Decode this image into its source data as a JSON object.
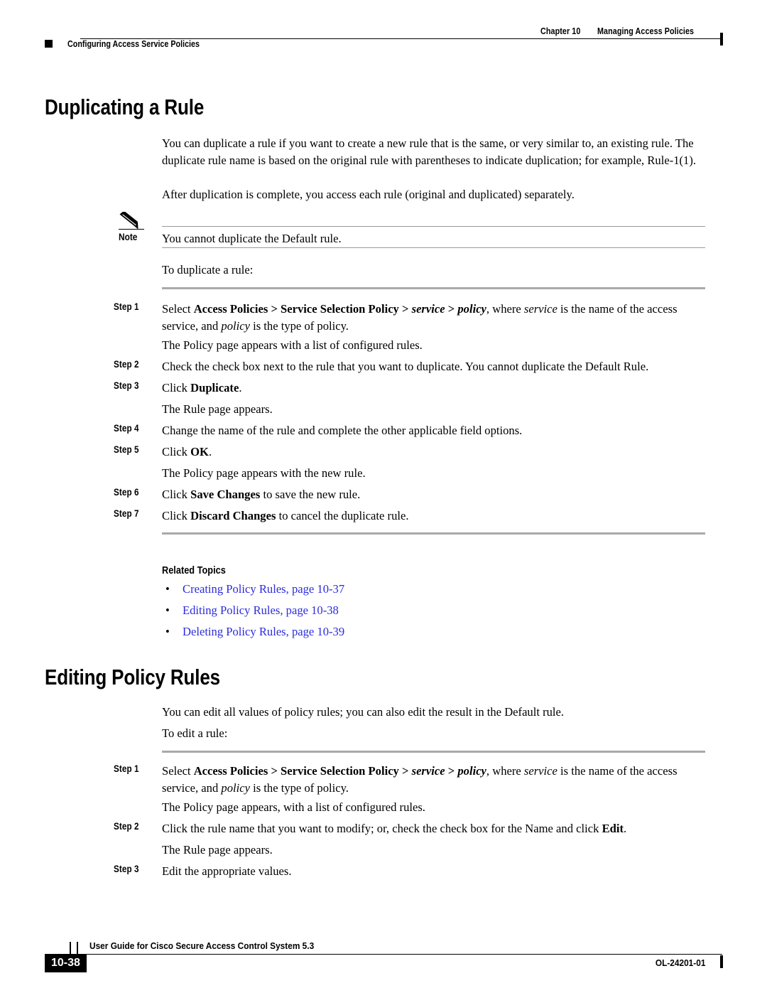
{
  "header": {
    "chapter": "Chapter 10",
    "chapter_title": "Managing Access Policies",
    "section_marker_label": "Configuring Access Service Policies"
  },
  "sections": [
    {
      "heading": "Duplicating a Rule",
      "intro_1": "You can duplicate a rule if you want to create a new rule that is the same, or very similar to, an existing rule. The duplicate rule name is based on the original rule with parentheses to indicate duplication; for example, Rule-1(1).",
      "intro_2": "After duplication is complete, you access each rule (original and duplicated) separately.",
      "note": {
        "label": "Note",
        "text": "You cannot duplicate the Default rule."
      },
      "lead_in": "To duplicate a rule:",
      "steps": [
        {
          "label": "Step 1",
          "segments": [
            {
              "t": "Select ",
              "s": "normal"
            },
            {
              "t": "Access Policies > Service Selection Policy > ",
              "s": "bold"
            },
            {
              "t": "service",
              "s": "bolditalic"
            },
            {
              "t": " > ",
              "s": "bold"
            },
            {
              "t": "policy",
              "s": "bolditalic"
            },
            {
              "t": ", where ",
              "s": "normal"
            },
            {
              "t": "service",
              "s": "italic"
            },
            {
              "t": " is the name of the access service, and ",
              "s": "normal"
            },
            {
              "t": "policy",
              "s": "italic"
            },
            {
              "t": " is the type of policy.",
              "s": "normal"
            }
          ],
          "result": "The Policy page appears with a list of configured rules."
        },
        {
          "label": "Step 2",
          "segments": [
            {
              "t": "Check the check box next to the rule that you want to duplicate. You cannot duplicate the Default Rule.",
              "s": "normal"
            }
          ],
          "result": ""
        },
        {
          "label": "Step 3",
          "segments": [
            {
              "t": "Click ",
              "s": "normal"
            },
            {
              "t": "Duplicate",
              "s": "bold"
            },
            {
              "t": ".",
              "s": "normal"
            }
          ],
          "result": "The Rule page appears."
        },
        {
          "label": "Step 4",
          "segments": [
            {
              "t": "Change the name of the rule and complete the other applicable field options.",
              "s": "normal"
            }
          ],
          "result": ""
        },
        {
          "label": "Step 5",
          "segments": [
            {
              "t": "Click ",
              "s": "normal"
            },
            {
              "t": "OK",
              "s": "bold"
            },
            {
              "t": ".",
              "s": "normal"
            }
          ],
          "result": "The Policy page appears with the new rule."
        },
        {
          "label": "Step 6",
          "segments": [
            {
              "t": "Click ",
              "s": "normal"
            },
            {
              "t": "Save Changes",
              "s": "bold"
            },
            {
              "t": " to save the new rule.",
              "s": "normal"
            }
          ],
          "result": ""
        },
        {
          "label": "Step 7",
          "segments": [
            {
              "t": "Click ",
              "s": "normal"
            },
            {
              "t": "Discard Changes",
              "s": "bold"
            },
            {
              "t": " to cancel the duplicate rule.",
              "s": "normal"
            }
          ],
          "result": ""
        }
      ],
      "related_topics": {
        "title": "Related Topics",
        "bullet": "•",
        "items": [
          "Creating Policy Rules, page 10-37",
          "Editing Policy Rules, page 10-38",
          "Deleting Policy Rules, page 10-39"
        ],
        "link_color": "#2b2bdd"
      }
    },
    {
      "heading": "Editing Policy Rules",
      "intro_1": "You can edit all values of policy rules; you can also edit the result in the Default rule.",
      "lead_in": "To edit a rule:",
      "steps": [
        {
          "label": "Step 1",
          "segments": [
            {
              "t": "Select ",
              "s": "normal"
            },
            {
              "t": "Access Policies > Service Selection Policy > ",
              "s": "bold"
            },
            {
              "t": "service",
              "s": "bolditalic"
            },
            {
              "t": " > ",
              "s": "bold"
            },
            {
              "t": "policy",
              "s": "bolditalic"
            },
            {
              "t": ", where ",
              "s": "normal"
            },
            {
              "t": "service",
              "s": "italic"
            },
            {
              "t": " is the name of the access service, and ",
              "s": "normal"
            },
            {
              "t": "policy",
              "s": "italic"
            },
            {
              "t": " is the type of policy.",
              "s": "normal"
            }
          ],
          "result": "The Policy page appears, with a list of configured rules."
        },
        {
          "label": "Step 2",
          "segments": [
            {
              "t": "Click the rule name that you want to modify; or, check the check box for the Name and click ",
              "s": "normal"
            },
            {
              "t": "Edit",
              "s": "bold"
            },
            {
              "t": ".",
              "s": "normal"
            }
          ],
          "result": "The Rule page appears."
        },
        {
          "label": "Step 3",
          "segments": [
            {
              "t": "Edit the appropriate values.",
              "s": "normal"
            }
          ],
          "result": ""
        }
      ]
    }
  ],
  "footer": {
    "page_number": "10-38",
    "guide_title": "User Guide for Cisco Secure Access Control System 5.3",
    "doc_id": "OL-24201-01"
  }
}
